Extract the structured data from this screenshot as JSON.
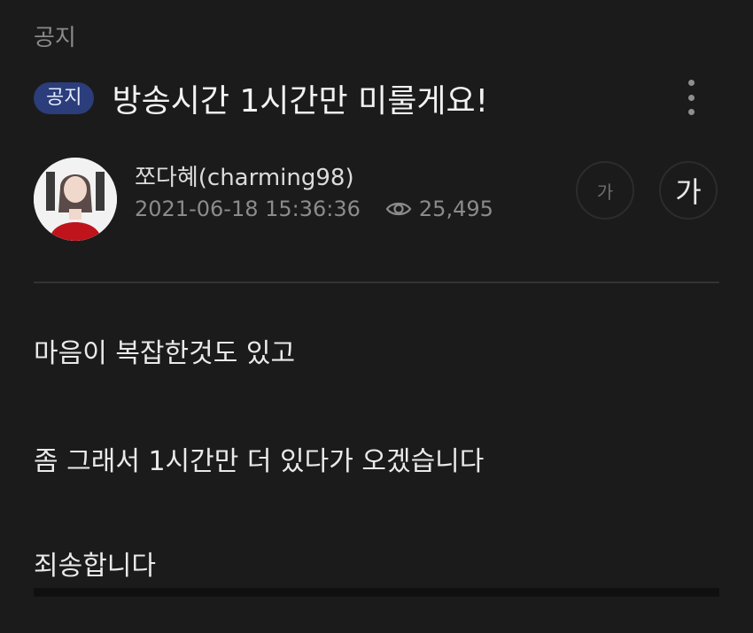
{
  "category": "공지",
  "post": {
    "badge": "공지",
    "title": "방송시간 1시간만 미룰게요!"
  },
  "author": {
    "name": "쪼다혜(charming98)",
    "datetime": "2021-06-18 15:36:36",
    "views": "25,495"
  },
  "font_controls": {
    "small_label": "가",
    "large_label": "가"
  },
  "body": {
    "lines": [
      "마음이 복잡한것도 있고",
      "좀 그래서 1시간만 더 있다가 오겠습니다",
      "죄송합니다"
    ]
  },
  "colors": {
    "background": "#1b1b1b",
    "badge_bg": "#2b3d7a",
    "muted_text": "#8b8b8b"
  },
  "icons": {
    "more": "more-vertical-icon",
    "views": "eye-icon"
  }
}
